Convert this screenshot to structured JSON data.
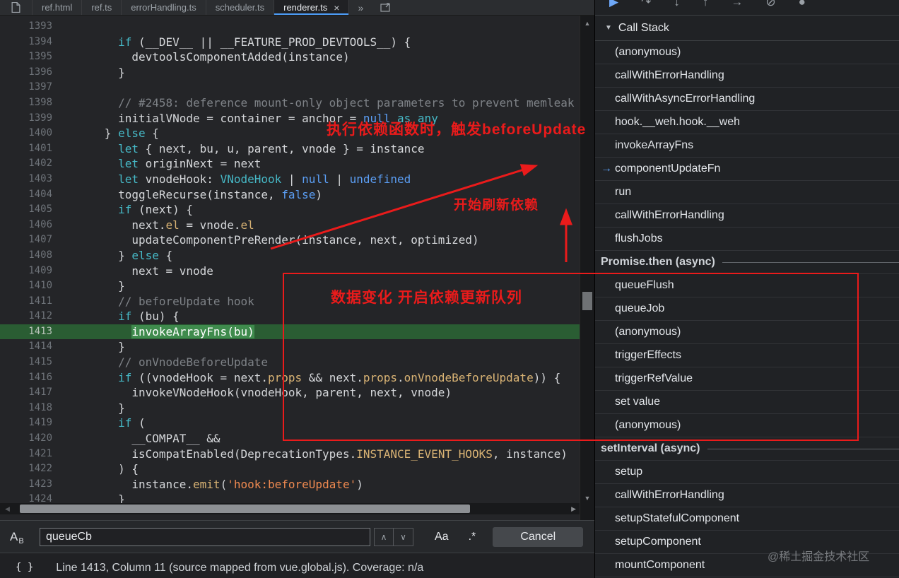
{
  "colors": {
    "accent_blue": "#4d9df8",
    "annotation_red": "#ea1b1b",
    "exec_line_green": "#2a5d33",
    "exec_token_green": "#3f8b4d"
  },
  "icons": {
    "scroll_up": "▲",
    "scroll_down": "▼",
    "scroll_left": "◀",
    "scroll_right": "▶",
    "search_prev": "∧",
    "search_next": "∨",
    "disclosure": "▼",
    "current_frame_arrow": "→"
  },
  "tab_bar": {
    "overflow": "»",
    "tabs": [
      {
        "label": "ref.html"
      },
      {
        "label": "ref.ts"
      },
      {
        "label": "errorHandling.ts"
      },
      {
        "label": "scheduler.ts"
      },
      {
        "label": "renderer.ts",
        "active": true,
        "close": "×"
      }
    ]
  },
  "debug_toolbar": {
    "buttons": [
      {
        "name": "resume-button",
        "glyph": "▶",
        "color": "blue"
      },
      {
        "name": "step-over-button",
        "glyph": "↷"
      },
      {
        "name": "step-into-button",
        "glyph": "↓"
      },
      {
        "name": "step-out-button",
        "glyph": "↑"
      },
      {
        "name": "step-button",
        "glyph": "→"
      },
      {
        "name": "deactivate-breakpoints-button",
        "glyph": "⊘"
      },
      {
        "name": "pause-on-exceptions-button",
        "glyph": "●"
      }
    ]
  },
  "editor": {
    "current_line": 1413,
    "lines": [
      {
        "n": 1393,
        "t": []
      },
      {
        "n": 1394,
        "t": [
          [
            "        "
          ],
          [
            "if",
            "kw"
          ],
          [
            " (__DEV__ || __FEATURE_PROD_DEVTOOLS__) {"
          ]
        ]
      },
      {
        "n": 1395,
        "t": [
          [
            "          devtoolsComponentAdded(instance)"
          ]
        ]
      },
      {
        "n": 1396,
        "t": [
          [
            "        }"
          ]
        ]
      },
      {
        "n": 1397,
        "t": []
      },
      {
        "n": 1398,
        "t": [
          [
            "        "
          ],
          [
            "// #2458: deference mount-only object parameters to prevent memleak",
            "com"
          ]
        ]
      },
      {
        "n": 1399,
        "t": [
          [
            "        initialVNode = container = anchor = "
          ],
          [
            "null",
            "atom"
          ],
          [
            " "
          ],
          [
            "as",
            "kw"
          ],
          [
            " "
          ],
          [
            "any",
            "kw"
          ]
        ]
      },
      {
        "n": 1400,
        "t": [
          [
            "      } "
          ],
          [
            "else",
            "kw"
          ],
          [
            " {"
          ]
        ]
      },
      {
        "n": 1401,
        "t": [
          [
            "        "
          ],
          [
            "let",
            "kw"
          ],
          [
            " { next, bu, u, parent, vnode } = instance"
          ]
        ]
      },
      {
        "n": 1402,
        "t": [
          [
            "        "
          ],
          [
            "let",
            "kw"
          ],
          [
            " originNext = next"
          ]
        ]
      },
      {
        "n": 1403,
        "t": [
          [
            "        "
          ],
          [
            "let",
            "kw"
          ],
          [
            " vnodeHook: "
          ],
          [
            "VNodeHook",
            "type"
          ],
          [
            " | "
          ],
          [
            "null",
            "atom"
          ],
          [
            " | "
          ],
          [
            "undefined",
            "atom"
          ]
        ]
      },
      {
        "n": 1404,
        "t": [
          [
            "        toggleRecurse(instance, "
          ],
          [
            "false",
            "atom"
          ],
          [
            ")"
          ]
        ]
      },
      {
        "n": 1405,
        "t": [
          [
            "        "
          ],
          [
            "if",
            "kw"
          ],
          [
            " (next) {"
          ]
        ]
      },
      {
        "n": 1406,
        "t": [
          [
            "          next."
          ],
          [
            "el",
            "prop"
          ],
          [
            " = vnode."
          ],
          [
            "el",
            "prop"
          ]
        ]
      },
      {
        "n": 1407,
        "t": [
          [
            "          updateComponentPreRender(instance, next, optimized)"
          ]
        ]
      },
      {
        "n": 1408,
        "t": [
          [
            "        } "
          ],
          [
            "else",
            "kw"
          ],
          [
            " {"
          ]
        ]
      },
      {
        "n": 1409,
        "t": [
          [
            "          next = vnode"
          ]
        ]
      },
      {
        "n": 1410,
        "t": [
          [
            "        }"
          ]
        ]
      },
      {
        "n": 1411,
        "t": [
          [
            "        "
          ],
          [
            "// beforeUpdate hook",
            "com"
          ]
        ]
      },
      {
        "n": 1412,
        "t": [
          [
            "        "
          ],
          [
            "if",
            "kw"
          ],
          [
            " (bu) {"
          ]
        ]
      },
      {
        "n": 1413,
        "cur": true,
        "t": [
          [
            "          "
          ],
          [
            "invokeArrayFns(bu)",
            "exec"
          ]
        ]
      },
      {
        "n": 1414,
        "t": [
          [
            "        }"
          ]
        ]
      },
      {
        "n": 1415,
        "t": [
          [
            "        "
          ],
          [
            "// onVnodeBeforeUpdate",
            "com"
          ]
        ]
      },
      {
        "n": 1416,
        "t": [
          [
            "        "
          ],
          [
            "if",
            "kw"
          ],
          [
            " ((vnodeHook = next."
          ],
          [
            "props",
            "prop"
          ],
          [
            " && next."
          ],
          [
            "props",
            "prop"
          ],
          [
            "."
          ],
          [
            "onVnodeBeforeUpdate",
            "prop"
          ],
          [
            ")) {"
          ]
        ]
      },
      {
        "n": 1417,
        "t": [
          [
            "          invokeVNodeHook(vnodeHook, parent, next, vnode)"
          ]
        ]
      },
      {
        "n": 1418,
        "t": [
          [
            "        }"
          ]
        ]
      },
      {
        "n": 1419,
        "t": [
          [
            "        "
          ],
          [
            "if",
            "kw"
          ],
          [
            " ("
          ]
        ]
      },
      {
        "n": 1420,
        "t": [
          [
            "          __COMPAT__ &&"
          ]
        ]
      },
      {
        "n": 1421,
        "t": [
          [
            "          isCompatEnabled(DeprecationTypes."
          ],
          [
            "INSTANCE_EVENT_HOOKS",
            "prop"
          ],
          [
            ", instance)"
          ]
        ]
      },
      {
        "n": 1422,
        "t": [
          [
            "        ) {"
          ]
        ]
      },
      {
        "n": 1423,
        "t": [
          [
            "          instance."
          ],
          [
            "emit",
            "prop"
          ],
          [
            "("
          ],
          [
            "'hook:beforeUpdate'",
            "str"
          ],
          [
            ")"
          ]
        ]
      },
      {
        "n": 1424,
        "t": [
          [
            "        }"
          ]
        ]
      }
    ]
  },
  "callstack": {
    "title": "Call Stack",
    "frames": [
      {
        "label": "(anonymous)"
      },
      {
        "label": "callWithErrorHandling"
      },
      {
        "label": "callWithAsyncErrorHandling"
      },
      {
        "label": "hook.__weh.hook.__weh"
      },
      {
        "label": "invokeArrayFns"
      },
      {
        "label": "componentUpdateFn",
        "current": true
      },
      {
        "label": "run"
      },
      {
        "label": "callWithErrorHandling"
      },
      {
        "label": "flushJobs"
      },
      {
        "label": "Promise.then (async)",
        "async": true
      },
      {
        "label": "queueFlush"
      },
      {
        "label": "queueJob"
      },
      {
        "label": "(anonymous)"
      },
      {
        "label": "triggerEffects"
      },
      {
        "label": "triggerRefValue"
      },
      {
        "label": "set value"
      },
      {
        "label": "(anonymous)"
      },
      {
        "label": "setInterval (async)",
        "async": true
      },
      {
        "label": "setup"
      },
      {
        "label": "callWithErrorHandling"
      },
      {
        "label": "setupStatefulComponent"
      },
      {
        "label": "setupComponent"
      },
      {
        "label": "mountComponent"
      }
    ]
  },
  "search_bar": {
    "icon_letter_main": "A",
    "icon_letter_sub": "B",
    "value": "queueCb",
    "match_case_label": "Aa",
    "regex_label": ".*",
    "cancel_label": "Cancel"
  },
  "status_bar": {
    "pretty_print": "{ }",
    "text": "Line 1413, Column 11 (source mapped from vue.global.js). Coverage: n/a"
  },
  "annotations": {
    "note_top": "执行依赖函数时，触发beforeUpdate",
    "note_mid": "开始刷新依赖",
    "note_box": "数据变化 开启依赖更新队列"
  },
  "watermark": "@稀土掘金技术社区"
}
